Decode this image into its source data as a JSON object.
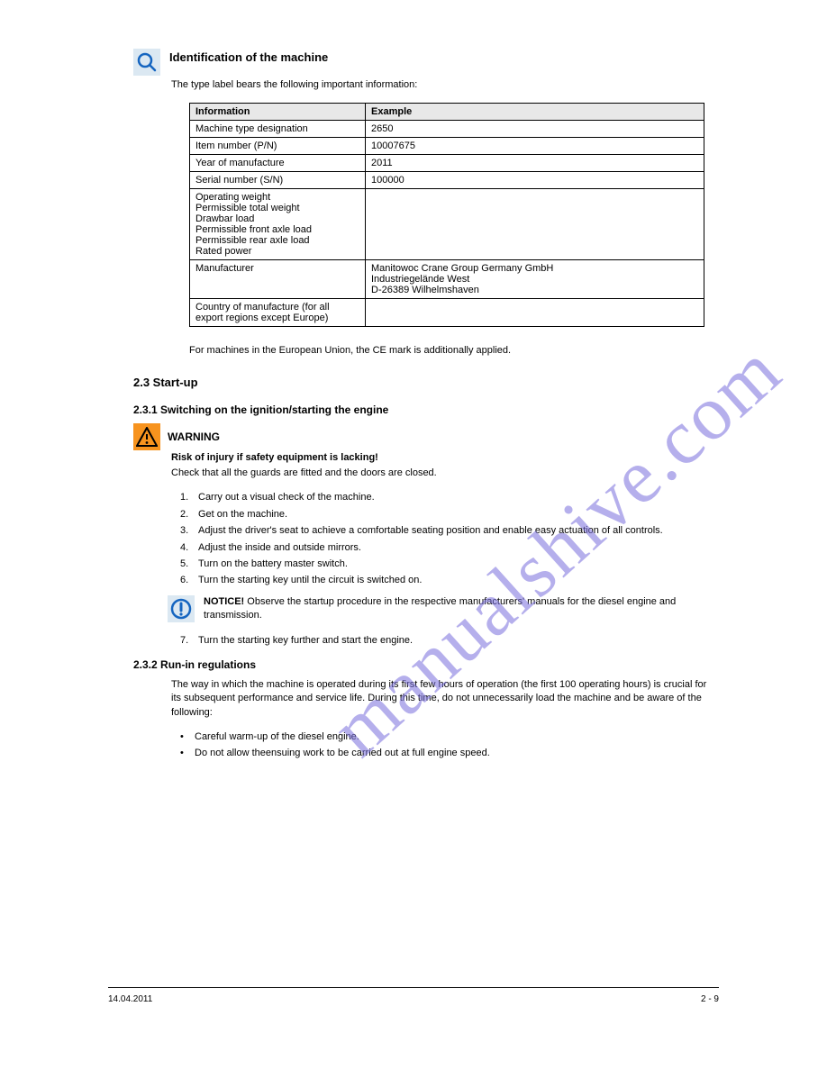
{
  "watermark": "manualshive.com",
  "section1": {
    "title": "Identification of the machine",
    "subtitle": "The type label bears the following important information:",
    "table": {
      "headers": [
        "Information",
        "Example"
      ],
      "rows": [
        [
          "Machine type designation",
          "2650"
        ],
        [
          "Item number (P/N)",
          "10007675"
        ],
        [
          "Year of manufacture",
          "2011"
        ],
        [
          "Serial number (S/N)",
          "100000"
        ],
        [
          "Operating weight",
          ""
        ],
        [
          "Permissible total weight",
          ""
        ],
        [
          "Drawbar load",
          ""
        ],
        [
          "Permissible front axle load",
          ""
        ],
        [
          "Permissible rear axle load",
          ""
        ],
        [
          "Rated power",
          ""
        ],
        [
          "Manufacturer",
          "Manitowoc Crane Group Germany GmbH\nIndustriegelände West\nD-26389 Wilhelmshaven"
        ],
        [
          "Country of manufacture (for all export regions except Europe)",
          ""
        ]
      ]
    },
    "after": "For machines in the European Union, the CE mark is additionally applied."
  },
  "section2": {
    "heading": "2.3    Start-up",
    "sub1": {
      "heading": "2.3.1    Switching on the ignition/starting the engine",
      "warn_title": "WARNING",
      "warn_sub": "Risk of injury if safety equipment is lacking!",
      "warn_body": "Check that all the guards are fitted and the doors are closed.",
      "steps": [
        "Carry out a visual check of the machine.",
        "Get on the machine.",
        "Adjust the driver's seat to achieve a comfortable seating position and enable easy actuation of all controls.",
        "Adjust the inside and outside mirrors.",
        "Turn on the battery master switch.",
        "Turn the starting key until the circuit is switched on."
      ],
      "notice_title": "NOTICE!",
      "notice_body": "Observe the startup procedure in the respective manufacturers' manuals for the diesel engine and transmission.",
      "final_step_num": "7.",
      "final_step_text": "Turn the starting key further and start the engine."
    },
    "sub2": {
      "heading": "2.3.2    Run-in regulations",
      "intro": "The way in which the machine is operated during its first few hours of operation (the first 100 operating hours) is crucial for its subsequent performance and service life. During this time, do not unnecessarily load the machine and be aware of the following:",
      "bullets": [
        "Careful warm-up of the diesel engine.",
        "Do not allow theensuing work to be carried out at full engine speed."
      ]
    }
  },
  "footer": {
    "left": "14.04.2011",
    "right": "2 - 9"
  }
}
